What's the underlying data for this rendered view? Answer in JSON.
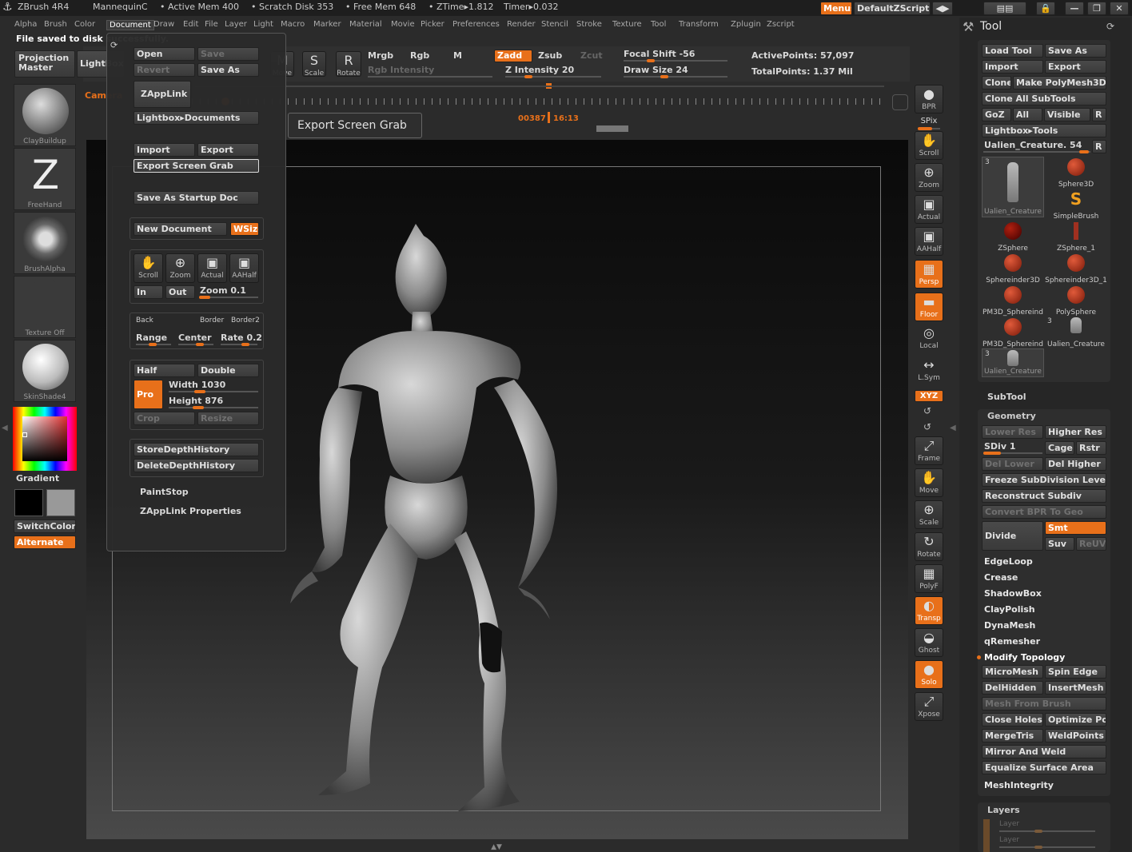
{
  "titlebar": {
    "app": "ZBrush 4R4",
    "doc": "MannequinC",
    "active_mem": "• Active Mem 400",
    "scratch": "• Scratch Disk 353",
    "free_mem": "• Free Mem 648",
    "ztime": "• ZTime▸1.812",
    "timer": "Timer▸0.032",
    "menus_btn": "Menus",
    "script_btn": "DefaultZScript"
  },
  "menubar": [
    "Alpha",
    "Brush",
    "Color",
    "Document",
    "Draw",
    "Edit",
    "File",
    "Layer",
    "Light",
    "Macro",
    "Marker",
    "Material",
    "Movie",
    "Picker",
    "Preferences",
    "Render",
    "Stencil",
    "Stroke",
    "Texture",
    "Tool",
    "Transform",
    "Zplugin",
    "Zscript"
  ],
  "status_msg": "File saved to disk successfully.",
  "top_shelf": {
    "projection": "Projection\nMaster",
    "lightbox": "LightBox",
    "move": "Move",
    "scale": "Scale",
    "rotate": "Rotate",
    "mrgb": "Mrgb",
    "rgb": "Rgb",
    "m": "M",
    "zadd": "Zadd",
    "zsub": "Zsub",
    "zcut": "Zcut",
    "rgb_intensity": "Rgb Intensity",
    "z_intensity": "Z Intensity 20",
    "focal_shift": "Focal Shift -56",
    "draw_size": "Draw Size 24",
    "active_points": "ActivePoints: 57,097",
    "total_points": "TotalPoints: 1.37 Mil",
    "camera": "Camera",
    "timeline_frame": "00387",
    "timeline_time": "16:13",
    "z_intensity_level": 0.2,
    "focal_shift_level": 0.22,
    "draw_size_level": 0.35
  },
  "left_shelf": {
    "brushes": [
      {
        "name": "ClayBuildup"
      },
      {
        "name": "FreeHand"
      },
      {
        "name": "BrushAlpha"
      },
      {
        "name": "Texture Off"
      },
      {
        "name": "SkinShade4"
      }
    ],
    "gradient": "Gradient",
    "switch_color": "SwitchColor",
    "alternate": "Alternate"
  },
  "document_menu": {
    "open": "Open",
    "save": "Save",
    "revert": "Revert",
    "save_as": "Save As",
    "zapplink": "ZAppLink",
    "lightbox_docs": "Lightbox▸Documents",
    "import": "Import",
    "export": "Export",
    "export_screen_grab": "Export Screen Grab",
    "save_startup": "Save As Startup Doc",
    "new_document": "New Document",
    "wsize": "WSize",
    "nav": [
      {
        "label": "Scroll",
        "icon": "scroll-icon"
      },
      {
        "label": "Zoom",
        "icon": "zoom-icon"
      },
      {
        "label": "Actual",
        "icon": "actual-icon"
      },
      {
        "label": "AAHalf",
        "icon": "aahalf-icon"
      }
    ],
    "in": "In",
    "out": "Out",
    "zoom": "Zoom 0.1",
    "back": "Back",
    "border": "Border",
    "border2": "Border2",
    "range": "Range",
    "center": "Center",
    "rate": "Rate 0.2",
    "half": "Half",
    "double": "Double",
    "pro": "Pro",
    "width": "Width 1030",
    "height": "Height 876",
    "crop": "Crop",
    "resize": "Resize",
    "store_depth": "StoreDepthHistory",
    "delete_depth": "DeleteDepthHistory",
    "paintstop": "PaintStop",
    "zapplink_props": "ZAppLink Properties"
  },
  "tooltip": "Export Screen Grab",
  "right_shelf": [
    {
      "label": "BPR",
      "icon": "bpr-sphere-icon",
      "on": false
    },
    {
      "label": "SPix",
      "icon": "spix-icon",
      "on": false
    },
    {
      "label": "Scroll",
      "icon": "scroll-icon",
      "on": false
    },
    {
      "label": "Zoom",
      "icon": "zoom-icon",
      "on": false
    },
    {
      "label": "Actual",
      "icon": "actual-icon",
      "on": false
    },
    {
      "label": "AAHalf",
      "icon": "aahalf-icon",
      "on": false
    },
    {
      "label": "Persp",
      "icon": "persp-icon",
      "on": true
    },
    {
      "label": "Floor",
      "icon": "floor-icon",
      "on": true
    },
    {
      "label": "Local",
      "icon": "local-icon",
      "on": false
    },
    {
      "label": "L.Sym",
      "icon": "lsym-icon",
      "on": false
    },
    {
      "label": "XYZ",
      "icon": "xyz-icon",
      "on": true
    },
    {
      "label": "Frame",
      "icon": "frame-icon",
      "on": false
    },
    {
      "label": "Move",
      "icon": "move-icon",
      "on": false
    },
    {
      "label": "Scale",
      "icon": "scale-icon",
      "on": false
    },
    {
      "label": "Rotate",
      "icon": "rotate-icon",
      "on": false
    },
    {
      "label": "PolyF",
      "icon": "polyf-icon",
      "on": false
    },
    {
      "label": "Transp",
      "icon": "transp-icon",
      "on": true
    },
    {
      "label": "Ghost",
      "icon": "ghost-icon",
      "on": false
    },
    {
      "label": "Solo",
      "icon": "solo-icon",
      "on": true
    },
    {
      "label": "Xpose",
      "icon": "xpose-icon",
      "on": false
    }
  ],
  "tool_panel": {
    "title": "Tool",
    "load_tool": "Load Tool",
    "save_as": "Save As",
    "import": "Import",
    "export": "Export",
    "clone": "Clone",
    "make_polymesh": "Make PolyMesh3D",
    "clone_all": "Clone All SubTools",
    "goz": "GoZ",
    "all": "All",
    "visible": "Visible",
    "r": "R",
    "lightbox_tools": "Lightbox▸Tools",
    "current_tool": "Ualien_Creature. 54",
    "tools": [
      "Ualien_Creature",
      "Sphere3D",
      "SimpleBrush",
      "ZSphere",
      "ZSphere_1",
      "Sphereinder3D",
      "Sphereinder3D_1",
      "PM3D_Sphereind",
      "PolySphere",
      "PM3D_Sphereind",
      "Ualien_Creature",
      "Ualien_Creature"
    ],
    "subtool": "SubTool",
    "geometry": "Geometry",
    "lower_res": "Lower Res",
    "higher_res": "Higher Res",
    "sdiv": "SDiv 1",
    "cage": "Cage",
    "rstr": "Rstr",
    "del_lower": "Del Lower",
    "del_higher": "Del Higher",
    "freeze": "Freeze SubDivision Levels",
    "reconstruct": "Reconstruct Subdiv",
    "convert_bpr": "Convert BPR To Geo",
    "divide": "Divide",
    "smt": "Smt",
    "suv": "Suv",
    "reuv": "ReUV",
    "edgeloop": "EdgeLoop",
    "crease": "Crease",
    "shadowbox": "ShadowBox",
    "claypolish": "ClayPolish",
    "dynamesh": "DynaMesh",
    "qremesher": "qRemesher",
    "modify_topology": "Modify Topology",
    "micromesh": "MicroMesh",
    "spin_edge": "Spin Edge",
    "delhidden": "DelHidden",
    "insertmesh": "InsertMesh",
    "mesh_from_brush": "Mesh From Brush",
    "close_holes": "Close Holes",
    "optimize": "Optimize Poi",
    "mergetris": "MergeTris",
    "weldpoints": "WeldPoints",
    "mirror_weld": "Mirror And Weld",
    "equalize": "Equalize Surface Area",
    "meshintegrity": "MeshIntegrity",
    "layers": "Layers",
    "layer": "Layer"
  }
}
